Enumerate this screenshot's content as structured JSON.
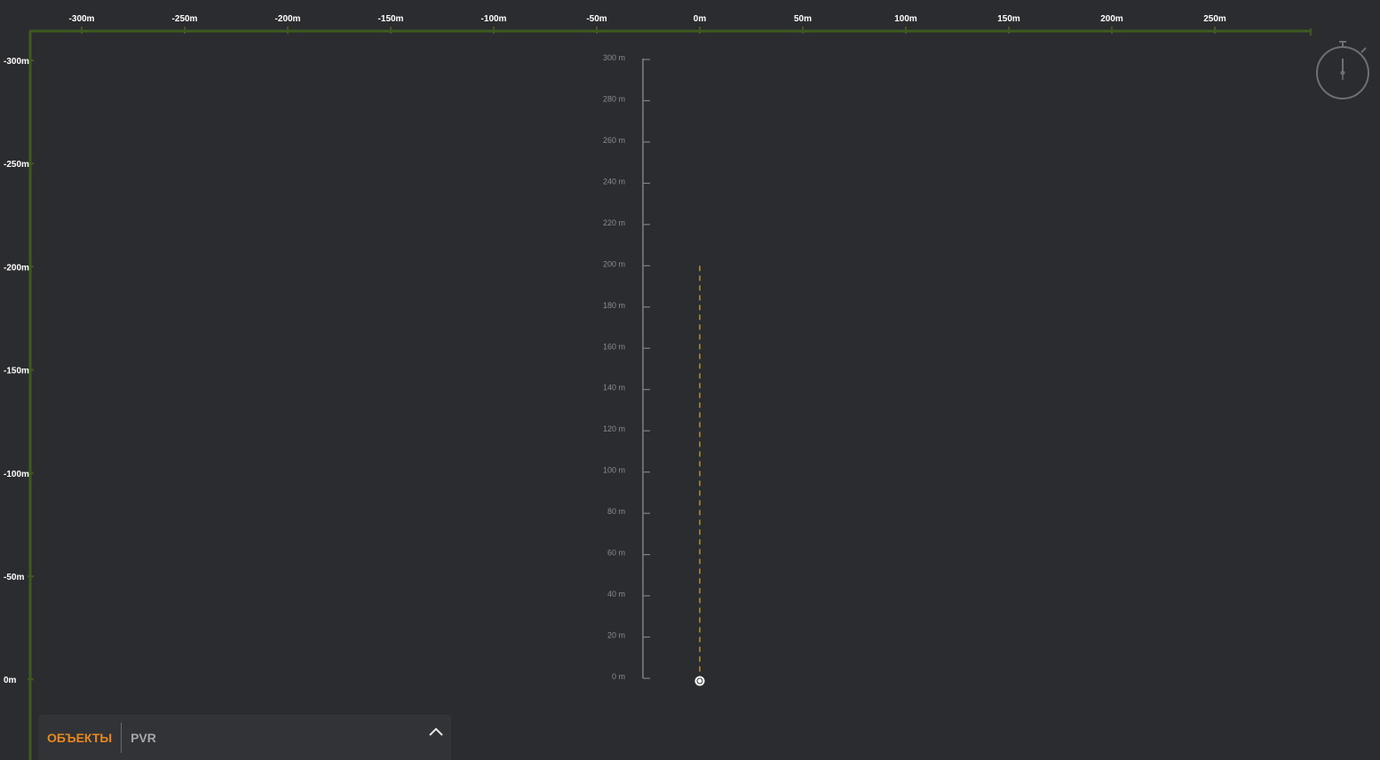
{
  "top_ruler": {
    "labels": [
      "-300m",
      "-250m",
      "-200m",
      "-150m",
      "-100m",
      "-50m",
      "0m",
      "50m",
      "100m",
      "150m",
      "200m",
      "250m"
    ]
  },
  "left_ruler": {
    "labels": [
      "-300m",
      "-250m",
      "-200m",
      "-150m",
      "-100m",
      "-50m",
      "0m"
    ]
  },
  "altitude_scale": {
    "labels": [
      "300 m",
      "280 m",
      "260 m",
      "240 m",
      "220 m",
      "200 m",
      "180 m",
      "160 m",
      "140 m",
      "120 m",
      "100 m",
      "80 m",
      "60 m",
      "40 m",
      "20 m",
      "0 m"
    ]
  },
  "drone": {
    "altitude_m": 200,
    "offset_x_m": 0,
    "offset_y_m": 0
  },
  "colors": {
    "background": "#2b2c30",
    "ruler_line": "#3e5a1e",
    "path_line": "#c9a227",
    "accent": "#e8891b"
  },
  "bottom_panel": {
    "tab_objects": "ОБЪЕКТЫ",
    "tab_pvr": "PVR",
    "collapse_icon": "chevron-up-icon"
  },
  "stopwatch_icon": "stopwatch-icon"
}
